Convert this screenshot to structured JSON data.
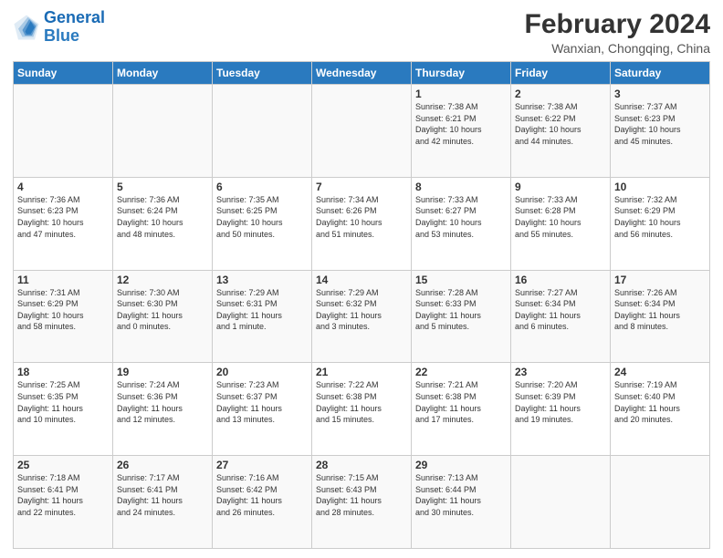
{
  "header": {
    "logo": {
      "general": "General",
      "blue": "Blue"
    },
    "month_year": "February 2024",
    "location": "Wanxian, Chongqing, China"
  },
  "calendar": {
    "days_of_week": [
      "Sunday",
      "Monday",
      "Tuesday",
      "Wednesday",
      "Thursday",
      "Friday",
      "Saturday"
    ],
    "weeks": [
      [
        {
          "day": "",
          "info": ""
        },
        {
          "day": "",
          "info": ""
        },
        {
          "day": "",
          "info": ""
        },
        {
          "day": "",
          "info": ""
        },
        {
          "day": "1",
          "info": "Sunrise: 7:38 AM\nSunset: 6:21 PM\nDaylight: 10 hours\nand 42 minutes."
        },
        {
          "day": "2",
          "info": "Sunrise: 7:38 AM\nSunset: 6:22 PM\nDaylight: 10 hours\nand 44 minutes."
        },
        {
          "day": "3",
          "info": "Sunrise: 7:37 AM\nSunset: 6:23 PM\nDaylight: 10 hours\nand 45 minutes."
        }
      ],
      [
        {
          "day": "4",
          "info": "Sunrise: 7:36 AM\nSunset: 6:23 PM\nDaylight: 10 hours\nand 47 minutes."
        },
        {
          "day": "5",
          "info": "Sunrise: 7:36 AM\nSunset: 6:24 PM\nDaylight: 10 hours\nand 48 minutes."
        },
        {
          "day": "6",
          "info": "Sunrise: 7:35 AM\nSunset: 6:25 PM\nDaylight: 10 hours\nand 50 minutes."
        },
        {
          "day": "7",
          "info": "Sunrise: 7:34 AM\nSunset: 6:26 PM\nDaylight: 10 hours\nand 51 minutes."
        },
        {
          "day": "8",
          "info": "Sunrise: 7:33 AM\nSunset: 6:27 PM\nDaylight: 10 hours\nand 53 minutes."
        },
        {
          "day": "9",
          "info": "Sunrise: 7:33 AM\nSunset: 6:28 PM\nDaylight: 10 hours\nand 55 minutes."
        },
        {
          "day": "10",
          "info": "Sunrise: 7:32 AM\nSunset: 6:29 PM\nDaylight: 10 hours\nand 56 minutes."
        }
      ],
      [
        {
          "day": "11",
          "info": "Sunrise: 7:31 AM\nSunset: 6:29 PM\nDaylight: 10 hours\nand 58 minutes."
        },
        {
          "day": "12",
          "info": "Sunrise: 7:30 AM\nSunset: 6:30 PM\nDaylight: 11 hours\nand 0 minutes."
        },
        {
          "day": "13",
          "info": "Sunrise: 7:29 AM\nSunset: 6:31 PM\nDaylight: 11 hours\nand 1 minute."
        },
        {
          "day": "14",
          "info": "Sunrise: 7:29 AM\nSunset: 6:32 PM\nDaylight: 11 hours\nand 3 minutes."
        },
        {
          "day": "15",
          "info": "Sunrise: 7:28 AM\nSunset: 6:33 PM\nDaylight: 11 hours\nand 5 minutes."
        },
        {
          "day": "16",
          "info": "Sunrise: 7:27 AM\nSunset: 6:34 PM\nDaylight: 11 hours\nand 6 minutes."
        },
        {
          "day": "17",
          "info": "Sunrise: 7:26 AM\nSunset: 6:34 PM\nDaylight: 11 hours\nand 8 minutes."
        }
      ],
      [
        {
          "day": "18",
          "info": "Sunrise: 7:25 AM\nSunset: 6:35 PM\nDaylight: 11 hours\nand 10 minutes."
        },
        {
          "day": "19",
          "info": "Sunrise: 7:24 AM\nSunset: 6:36 PM\nDaylight: 11 hours\nand 12 minutes."
        },
        {
          "day": "20",
          "info": "Sunrise: 7:23 AM\nSunset: 6:37 PM\nDaylight: 11 hours\nand 13 minutes."
        },
        {
          "day": "21",
          "info": "Sunrise: 7:22 AM\nSunset: 6:38 PM\nDaylight: 11 hours\nand 15 minutes."
        },
        {
          "day": "22",
          "info": "Sunrise: 7:21 AM\nSunset: 6:38 PM\nDaylight: 11 hours\nand 17 minutes."
        },
        {
          "day": "23",
          "info": "Sunrise: 7:20 AM\nSunset: 6:39 PM\nDaylight: 11 hours\nand 19 minutes."
        },
        {
          "day": "24",
          "info": "Sunrise: 7:19 AM\nSunset: 6:40 PM\nDaylight: 11 hours\nand 20 minutes."
        }
      ],
      [
        {
          "day": "25",
          "info": "Sunrise: 7:18 AM\nSunset: 6:41 PM\nDaylight: 11 hours\nand 22 minutes."
        },
        {
          "day": "26",
          "info": "Sunrise: 7:17 AM\nSunset: 6:41 PM\nDaylight: 11 hours\nand 24 minutes."
        },
        {
          "day": "27",
          "info": "Sunrise: 7:16 AM\nSunset: 6:42 PM\nDaylight: 11 hours\nand 26 minutes."
        },
        {
          "day": "28",
          "info": "Sunrise: 7:15 AM\nSunset: 6:43 PM\nDaylight: 11 hours\nand 28 minutes."
        },
        {
          "day": "29",
          "info": "Sunrise: 7:13 AM\nSunset: 6:44 PM\nDaylight: 11 hours\nand 30 minutes."
        },
        {
          "day": "",
          "info": ""
        },
        {
          "day": "",
          "info": ""
        }
      ]
    ]
  }
}
